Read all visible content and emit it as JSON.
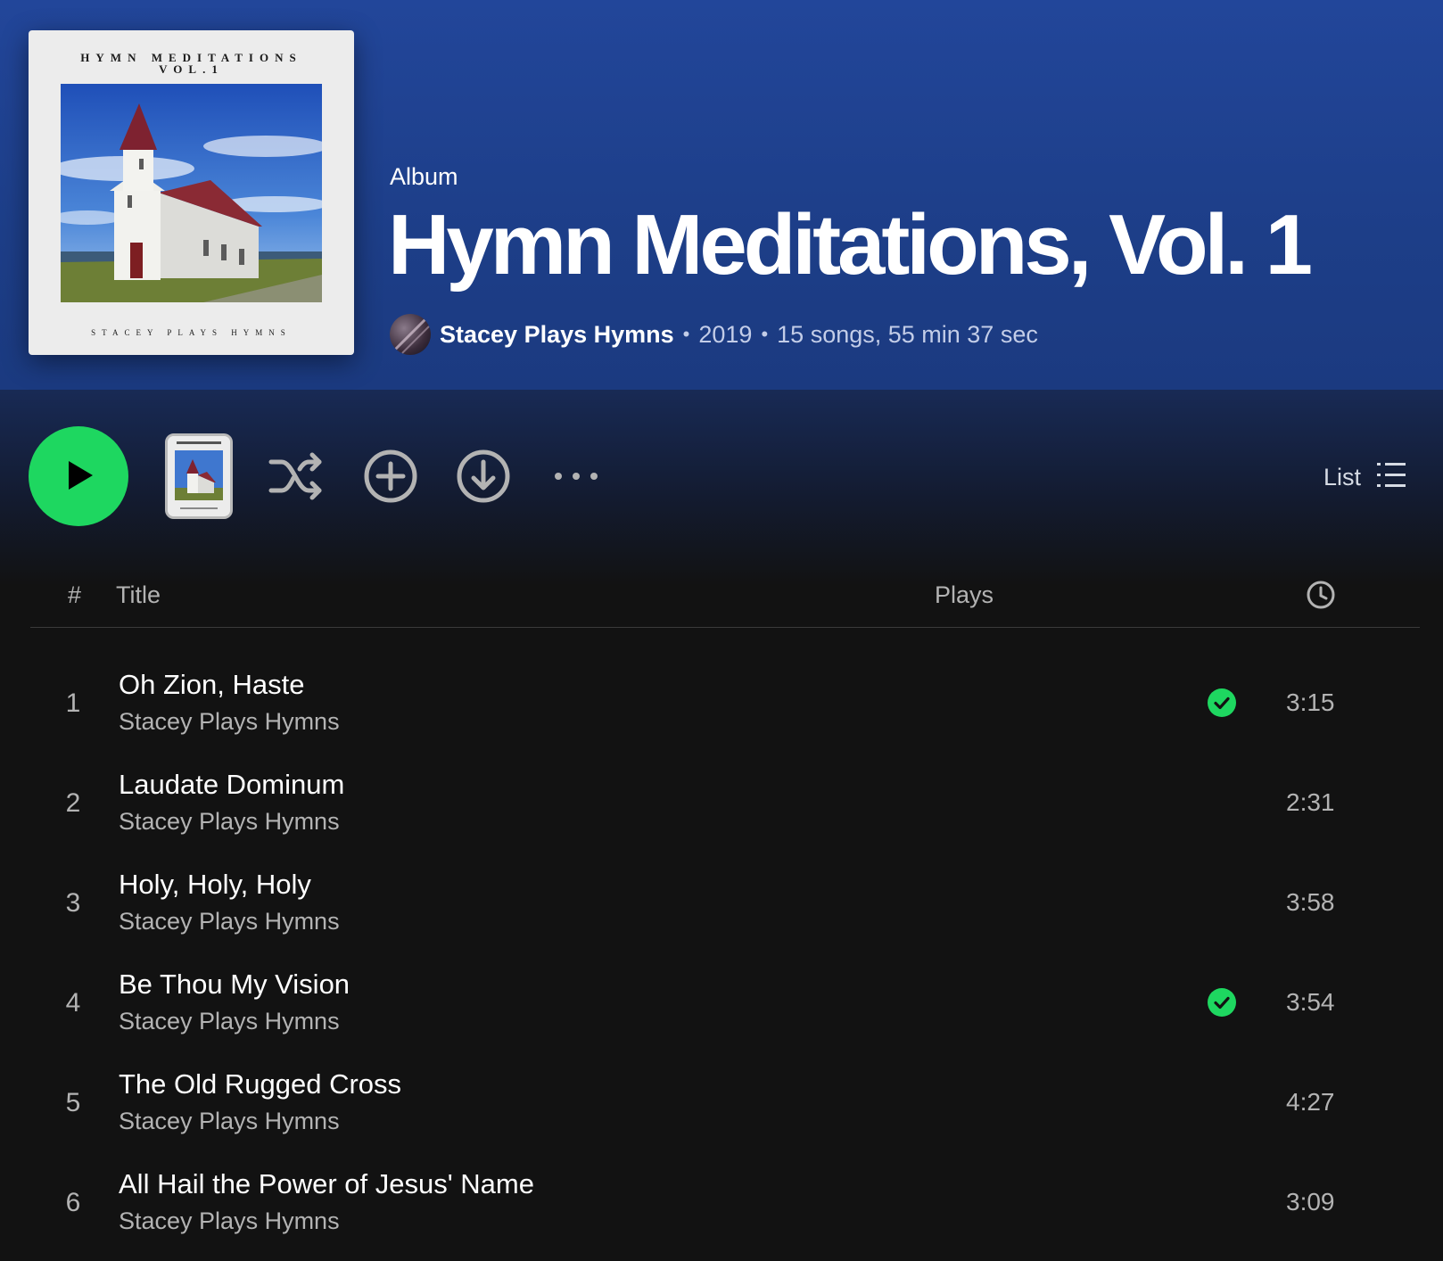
{
  "header": {
    "cover": {
      "top_line1": "HYMN MEDITATIONS",
      "top_line2": "VOL.1",
      "bottom": "STACEY PLAYS HYMNS"
    },
    "type": "Album",
    "title": "Hymn Meditations, Vol. 1",
    "artist": "Stacey Plays Hymns",
    "year": "2019",
    "summary": "15 songs, 55 min 37 sec"
  },
  "controls": {
    "play_icon": "play-icon",
    "shuffle_icon": "shuffle-icon",
    "add_icon": "add-circle-icon",
    "download_icon": "download-circle-icon",
    "more_icon": "more-icon",
    "view_label": "List",
    "view_icon": "list-icon"
  },
  "table": {
    "col_num": "#",
    "col_title": "Title",
    "col_plays": "Plays",
    "col_duration_icon": "clock-icon"
  },
  "tracks": [
    {
      "num": "1",
      "title": "Oh Zion, Haste",
      "artist": "Stacey Plays Hymns",
      "duration": "3:15",
      "saved": true
    },
    {
      "num": "2",
      "title": "Laudate Dominum",
      "artist": "Stacey Plays Hymns",
      "duration": "2:31",
      "saved": false
    },
    {
      "num": "3",
      "title": "Holy, Holy, Holy",
      "artist": "Stacey Plays Hymns",
      "duration": "3:58",
      "saved": false
    },
    {
      "num": "4",
      "title": "Be Thou My Vision",
      "artist": "Stacey Plays Hymns",
      "duration": "3:54",
      "saved": true
    },
    {
      "num": "5",
      "title": "The Old Rugged Cross",
      "artist": "Stacey Plays Hymns",
      "duration": "4:27",
      "saved": false
    },
    {
      "num": "6",
      "title": "All Hail the Power of Jesus' Name",
      "artist": "Stacey Plays Hymns",
      "duration": "3:09",
      "saved": false
    }
  ],
  "colors": {
    "accent": "#1ed760",
    "header_bg": "#22469a",
    "page_bg": "#121212"
  }
}
